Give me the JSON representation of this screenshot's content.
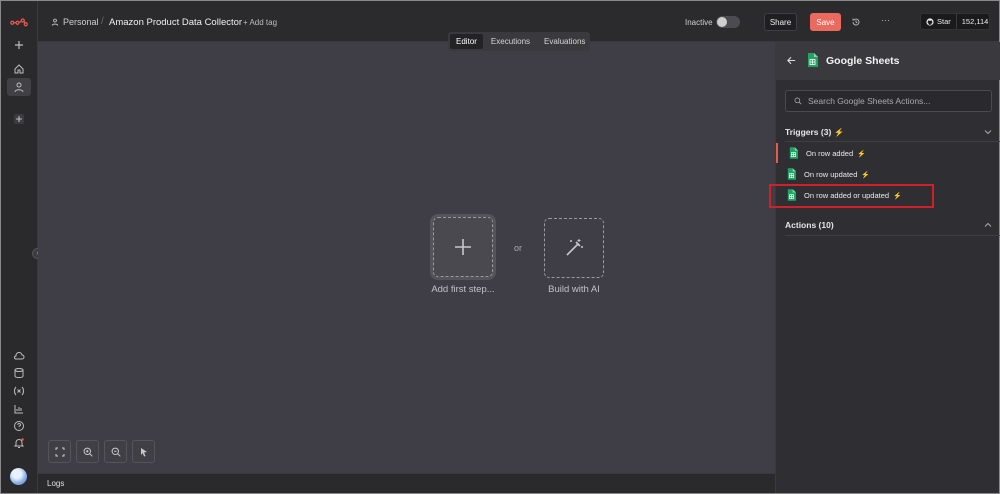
{
  "header": {
    "workspace": "Personal",
    "separator": "/",
    "workflow_title": "Amazon Product Data Collector",
    "add_tag": "+ Add tag",
    "status_label": "Inactive",
    "active": false,
    "share_label": "Share",
    "save_label": "Save",
    "more_label": "···",
    "github": {
      "star_label": "Star",
      "star_count": "152,114"
    }
  },
  "tabs": [
    {
      "label": "Editor",
      "active": true
    },
    {
      "label": "Executions",
      "active": false
    },
    {
      "label": "Evaluations",
      "active": false
    }
  ],
  "canvas": {
    "add_first_step": "Add first step...",
    "or": "or",
    "build_with_ai": "Build with AI"
  },
  "logs": {
    "label": "Logs"
  },
  "panel": {
    "title": "Google Sheets",
    "search_placeholder": "Search Google Sheets Actions...",
    "triggers_label": "Triggers (3)",
    "triggers": [
      {
        "label": "On row added",
        "selected": true
      },
      {
        "label": "On row updated",
        "selected": false
      },
      {
        "label": "On row added or updated",
        "selected": false,
        "highlighted": true
      }
    ],
    "actions_label": "Actions (10)"
  },
  "colors": {
    "accent": "#ea5a4f",
    "save_button": "#ea6a5f",
    "canvas_bg": "#3f3e46",
    "panel_bg": "#2f2f33",
    "highlight_box": "#d0202a",
    "sheets_green": "#21a366"
  },
  "icons": {
    "rail": [
      "n8n-logo-icon",
      "plus-icon",
      "home-icon",
      "user-icon",
      "plus-icon",
      "cloud-icon",
      "database-icon",
      "variables-icon",
      "chart-icon",
      "help-icon",
      "bell-icon"
    ],
    "zoom_bar": [
      "fit-view-icon",
      "zoom-in-icon",
      "zoom-out-icon",
      "pointer-icon"
    ]
  }
}
